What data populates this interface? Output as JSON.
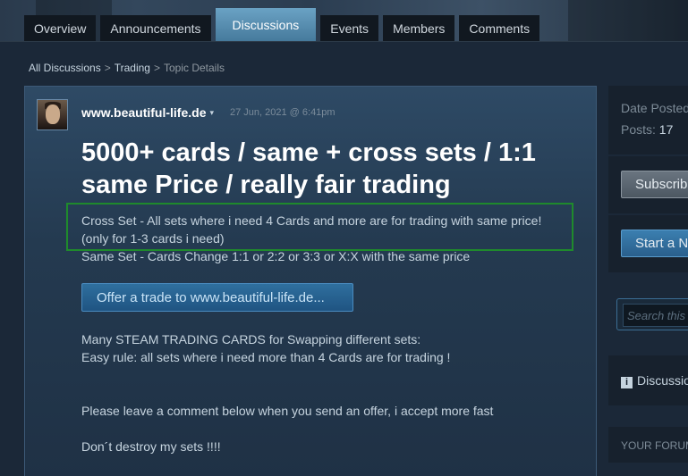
{
  "tabs": [
    "Overview",
    "Announcements",
    "Discussions",
    "Events",
    "Members",
    "Comments"
  ],
  "active_tab": "Discussions",
  "breadcrumb": {
    "all": "All Discussions",
    "sep1": ">",
    "forum": "Trading",
    "sep2": ">",
    "current": "Topic Details"
  },
  "topic": {
    "author": "www.beautiful-life.de",
    "caret": "▾",
    "date": "27 Jun, 2021 @ 6:41pm",
    "title_line1": "5000+ cards / same + cross sets / 1:1",
    "title_line2": "same Price / really fair trading",
    "cross_line1": "Cross Set - All sets where i need 4 Cards and more are for trading with same price!",
    "cross_line2": "(only for 1-3 cards i need)",
    "same_line": "Same Set - Cards Change 1:1 or 2:2 or 3:3 or X:X with the same price",
    "offer_button": "Offer a trade to www.beautiful-life.de...",
    "para1_line1": "Many STEAM TRADING CARDS for Swapping different sets:",
    "para1_line2": "Easy rule: all sets where i need more than 4 Cards are for trading !",
    "para2": "Please leave a comment below when you send an offer, i accept more fast",
    "para3": "Don´t destroy my sets !!!!"
  },
  "sidebar": {
    "date_posted": "Date Posted",
    "posts_label": "Posts:",
    "posts_value": "17",
    "subscribe": "Subscribe",
    "start_new": "Start a N",
    "search_placeholder": "Search this t",
    "discussions": "Discussio",
    "your_forum": "YOUR FORUM"
  },
  "colors": {
    "background": "#1b2838",
    "active_tab": "#5a8fb1",
    "highlight_border": "#1f8a2c",
    "offer_button": "#2a6596"
  }
}
